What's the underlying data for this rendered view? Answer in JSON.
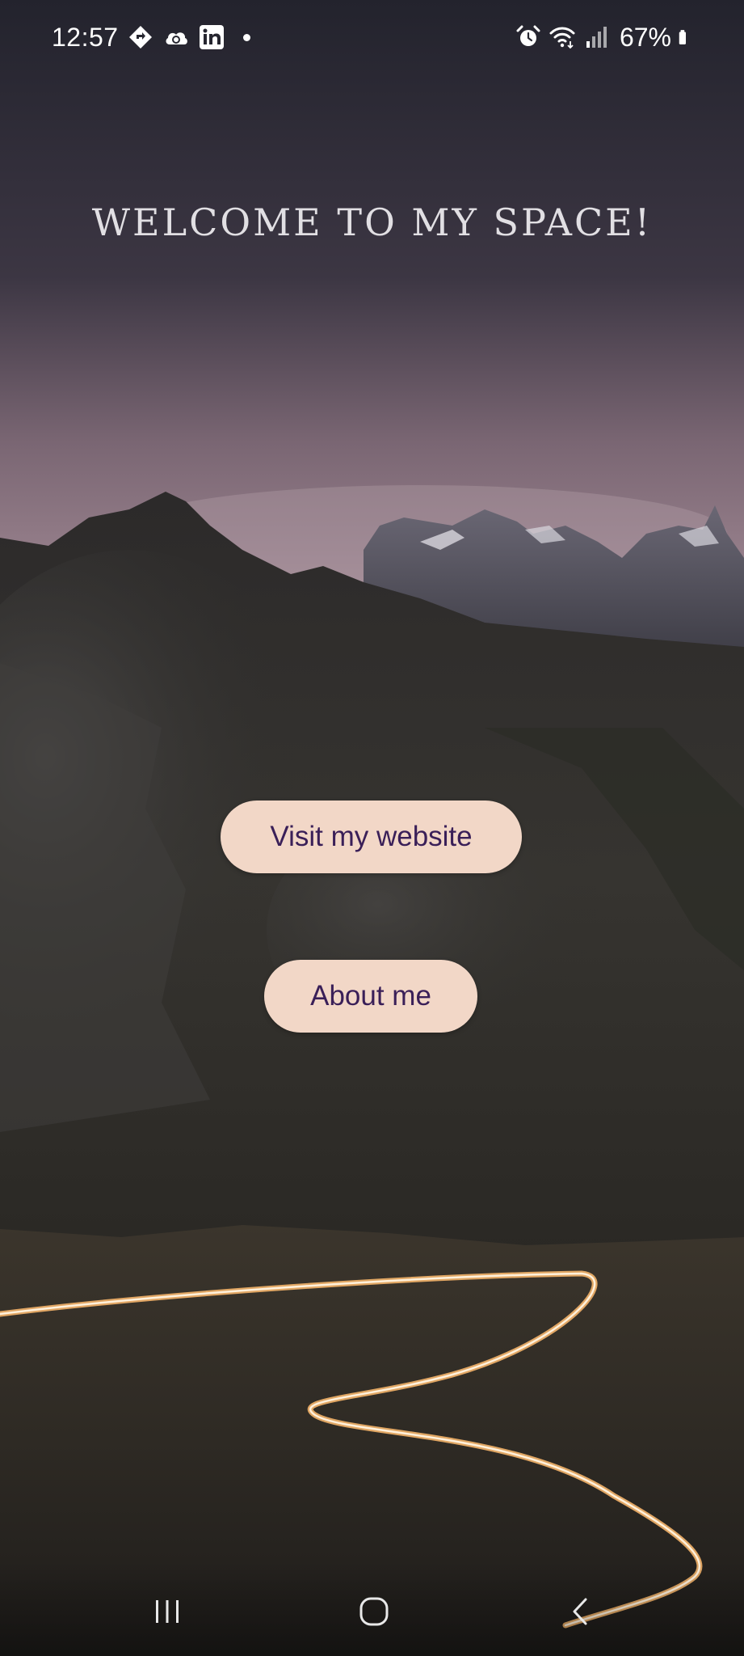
{
  "status_bar": {
    "time": "12:57",
    "left_icons": [
      "navigation-diamond-icon",
      "cloud-sync-icon",
      "linkedin-icon",
      "notification-dot"
    ],
    "right_icons": [
      "alarm-icon",
      "wifi-icon",
      "signal-icon",
      "battery-icon"
    ],
    "battery_percent": "67%"
  },
  "main": {
    "title": "Welcome to my space!",
    "buttons": {
      "visit_website": "Visit my website",
      "about_me": "About me"
    }
  },
  "nav_bar": {
    "icons": [
      "recents-icon",
      "home-icon",
      "back-icon"
    ]
  },
  "colors": {
    "button_bg": "#f2d7c7",
    "button_text": "#3a1f58",
    "title_text": "#e1dfe3"
  }
}
